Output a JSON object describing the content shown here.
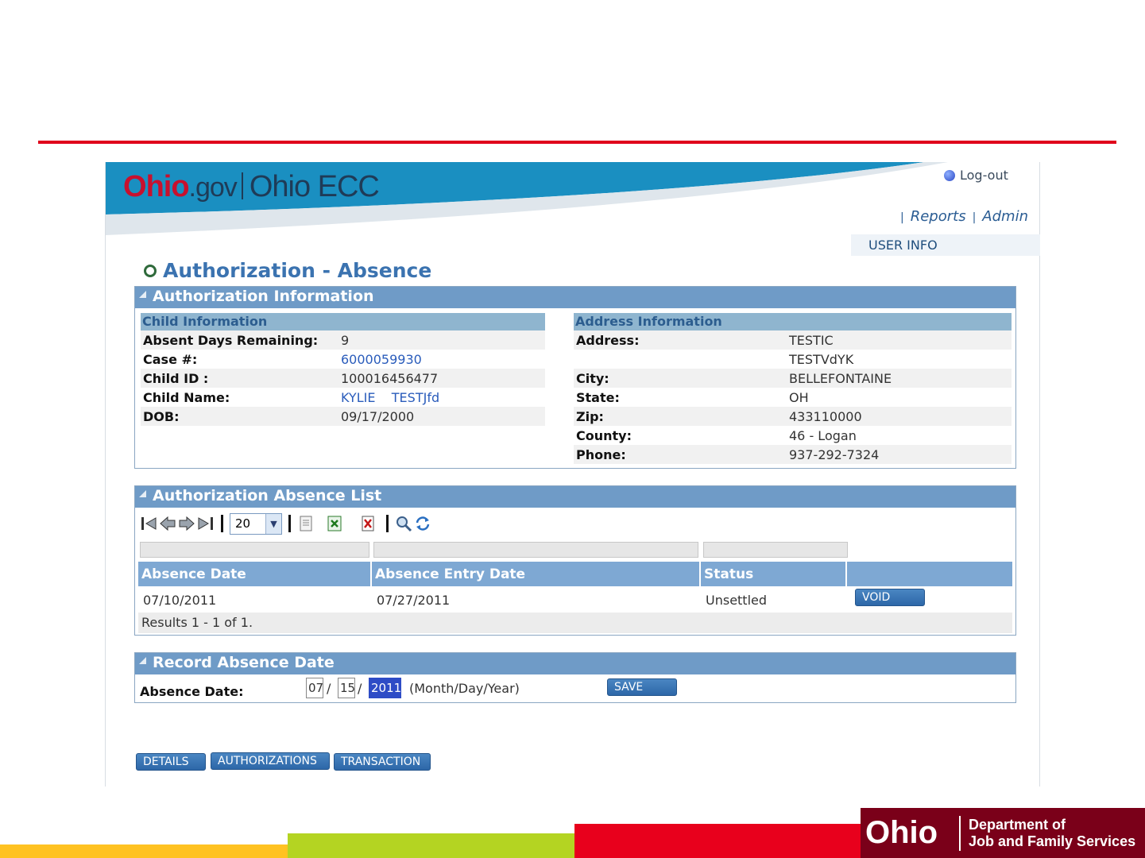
{
  "header": {
    "logo_o": "O",
    "logo_hio": "hio",
    "logo_gov": ".gov",
    "logo_app": "Ohio ECC",
    "logout": "Log-out",
    "links": [
      "Reports",
      "Admin"
    ],
    "user_info": "USER INFO"
  },
  "page_title": "Authorization - Absence",
  "auth_info": {
    "title": "Authorization Information",
    "child": {
      "heading": "Child Information",
      "rows": [
        {
          "label": "Absent Days Remaining:",
          "value": "9"
        },
        {
          "label": "Case #:",
          "value": "6000059930"
        },
        {
          "label": "Child ID :",
          "value": "100016456477"
        },
        {
          "label": "Child Name:",
          "value": "KYLIE    TESTJfd"
        },
        {
          "label": "DOB:",
          "value": "09/17/2000"
        }
      ]
    },
    "address": {
      "heading": "Address Information",
      "rows": [
        {
          "label": "Address:",
          "value": "TESTIC"
        },
        {
          "label": "",
          "value": "TESTVdYK"
        },
        {
          "label": "City:",
          "value": "BELLEFONTAINE"
        },
        {
          "label": "State:",
          "value": "OH"
        },
        {
          "label": "Zip:",
          "value": "433110000"
        },
        {
          "label": "County:",
          "value": "46 - Logan"
        },
        {
          "label": "Phone:",
          "value": "937-292-7324"
        }
      ]
    }
  },
  "absence_list": {
    "title": "Authorization Absence List",
    "page_size": "20",
    "columns": [
      "Absence Date",
      "Absence Entry Date",
      "Status",
      ""
    ],
    "rows": [
      {
        "absence_date": "07/10/2011",
        "entry_date": "07/27/2011",
        "status": "Unsettled",
        "action": "VOID"
      }
    ],
    "results": "Results 1 - 1 of 1."
  },
  "record_absence": {
    "title": "Record Absence Date",
    "label": "Absence Date:",
    "month": "07",
    "day": "15",
    "year": "2011",
    "sep": "/",
    "hint": "(Month/Day/Year)",
    "save": "SAVE"
  },
  "bottom_buttons": [
    "DETAILS",
    "AUTHORIZATIONS",
    "TRANSACTION"
  ],
  "footer": {
    "ohio": "Ohio",
    "dept_line1": "Department of",
    "dept_line2": "Job and Family Services"
  },
  "colors": {
    "accent_red": "#e0001b",
    "panel_blue": "#6f9bc7",
    "brand_maroon": "#7a0019"
  }
}
